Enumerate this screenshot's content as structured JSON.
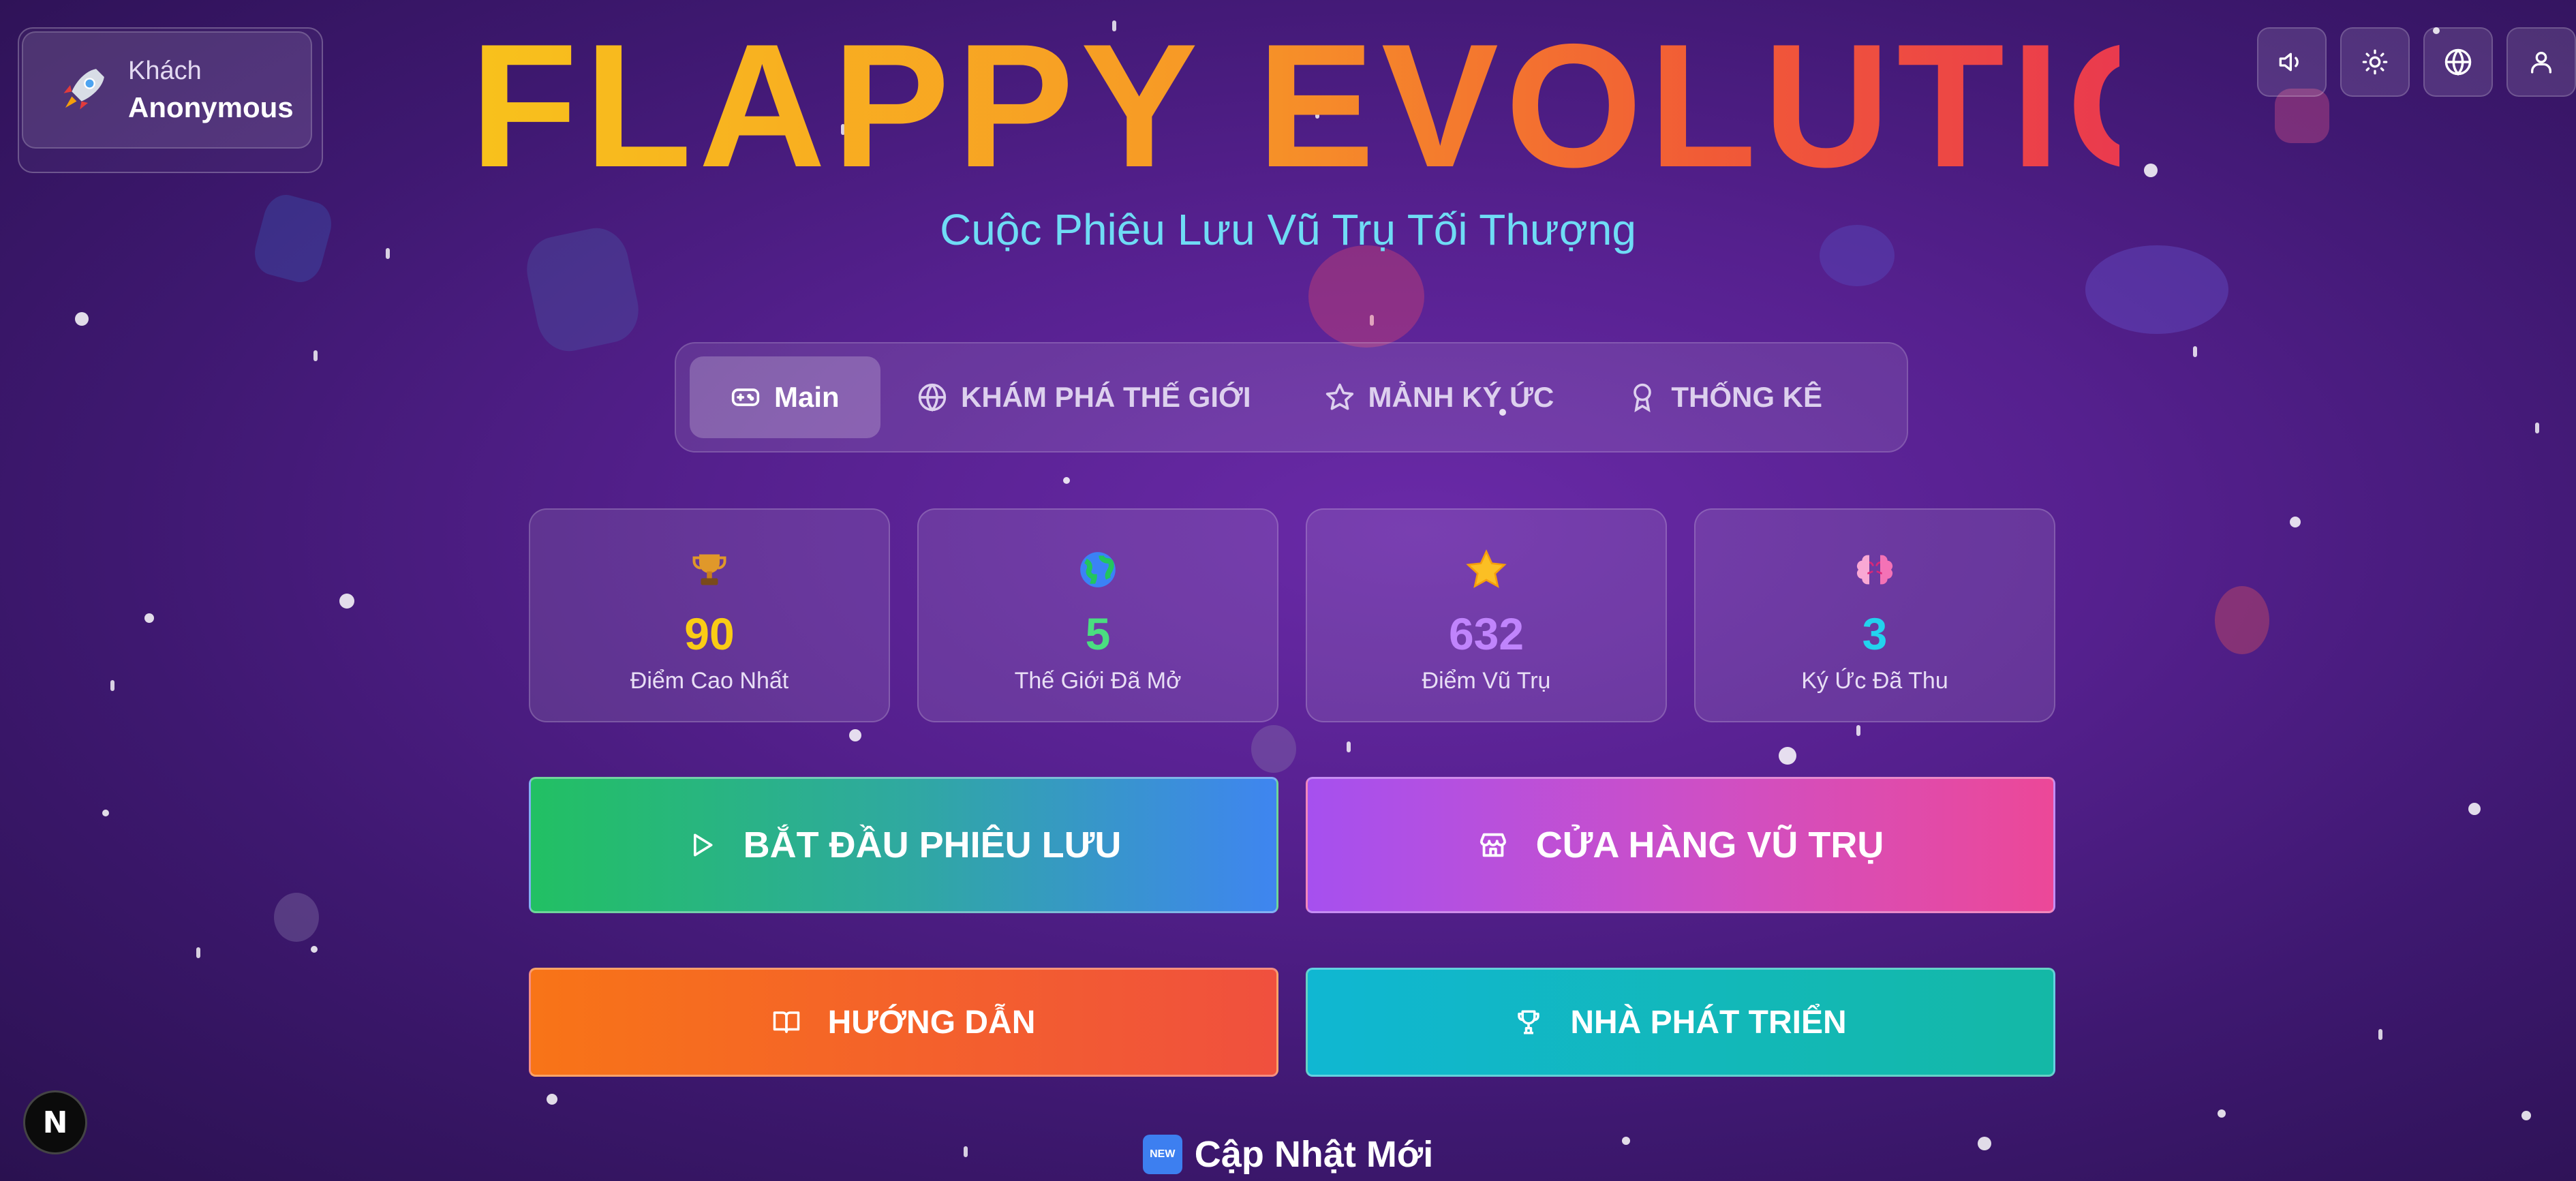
{
  "user": {
    "role": "Khách",
    "name": "Anonymous"
  },
  "top_buttons": [
    "volume-icon",
    "sun-icon",
    "globe-icon",
    "user-icon"
  ],
  "title": "FLAPPY EVOLUTION",
  "subtitle": "Cuộc Phiêu Lưu Vũ Trụ Tối Thượng",
  "tabs": [
    {
      "label": "Main",
      "icon": "gamepad-icon",
      "active": true
    },
    {
      "label": "KHÁM PHÁ THẾ GIỚI",
      "icon": "globe-icon",
      "active": false
    },
    {
      "label": "MẢNH KÝ ỨC",
      "icon": "star-icon",
      "active": false
    },
    {
      "label": "THỐNG KÊ",
      "icon": "award-icon",
      "active": false
    }
  ],
  "stats": [
    {
      "value": "90",
      "label": "Điểm Cao Nhất",
      "icon": "trophy-icon",
      "color": "#facc15"
    },
    {
      "value": "5",
      "label": "Thế Giới Đã Mở",
      "icon": "earth-icon",
      "color": "#4ade80"
    },
    {
      "value": "632",
      "label": "Điểm Vũ Trụ",
      "icon": "star-icon",
      "color": "#c084fc"
    },
    {
      "value": "3",
      "label": "Ký Ức Đã Thu",
      "icon": "brain-icon",
      "color": "#22d3ee"
    }
  ],
  "actions": {
    "start": "BẮT ĐẦU PHIÊU LƯU",
    "shop": "CỬA HÀNG VŨ TRỤ",
    "guide": "HƯỚNG DẪN",
    "developer": "NHÀ PHÁT TRIỂN"
  },
  "updates": {
    "badge": "NEW",
    "label": "Cập Nhật Mới"
  },
  "dev_badge": "N"
}
